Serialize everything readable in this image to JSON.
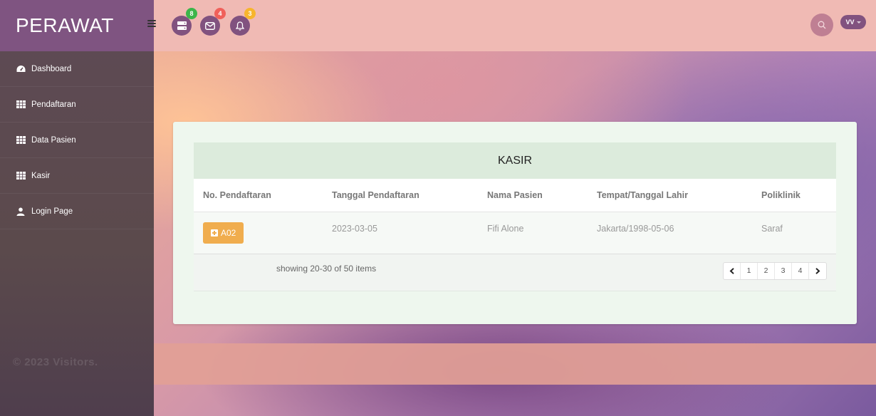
{
  "brand": {
    "title": "PERAWAT"
  },
  "sidebar": {
    "items": [
      {
        "label": "Dashboard",
        "icon": "dashboard-icon"
      },
      {
        "label": "Pendaftaran",
        "icon": "grid-icon"
      },
      {
        "label": "Data Pasien",
        "icon": "grid-icon"
      },
      {
        "label": "Kasir",
        "icon": "grid-icon"
      },
      {
        "label": "Login Page",
        "icon": "user-icon"
      }
    ],
    "footer": "© 2023 Visitors."
  },
  "topbar": {
    "badges": {
      "tasks": "8",
      "messages": "4",
      "notifications": "3"
    },
    "badge_colors": {
      "tasks": "#3cb54a",
      "messages": "#f0605a",
      "notifications": "#f7b52c"
    },
    "user_initials": "VV"
  },
  "kasir": {
    "title": "KASIR",
    "columns": [
      "No. Pendaftaran",
      "Tanggal Pendaftaran",
      "Nama Pasien",
      "Tempat/Tanggal Lahir",
      "Poliklinik"
    ],
    "rows": [
      {
        "no": "A02",
        "tanggal": "2023-03-05",
        "nama": "Fifi Alone",
        "ttl": "Jakarta/1998-05-06",
        "poli": "Saraf"
      }
    ],
    "showing": "showing 20-30 of 50 items",
    "pages": [
      "1",
      "2",
      "3",
      "4"
    ]
  }
}
